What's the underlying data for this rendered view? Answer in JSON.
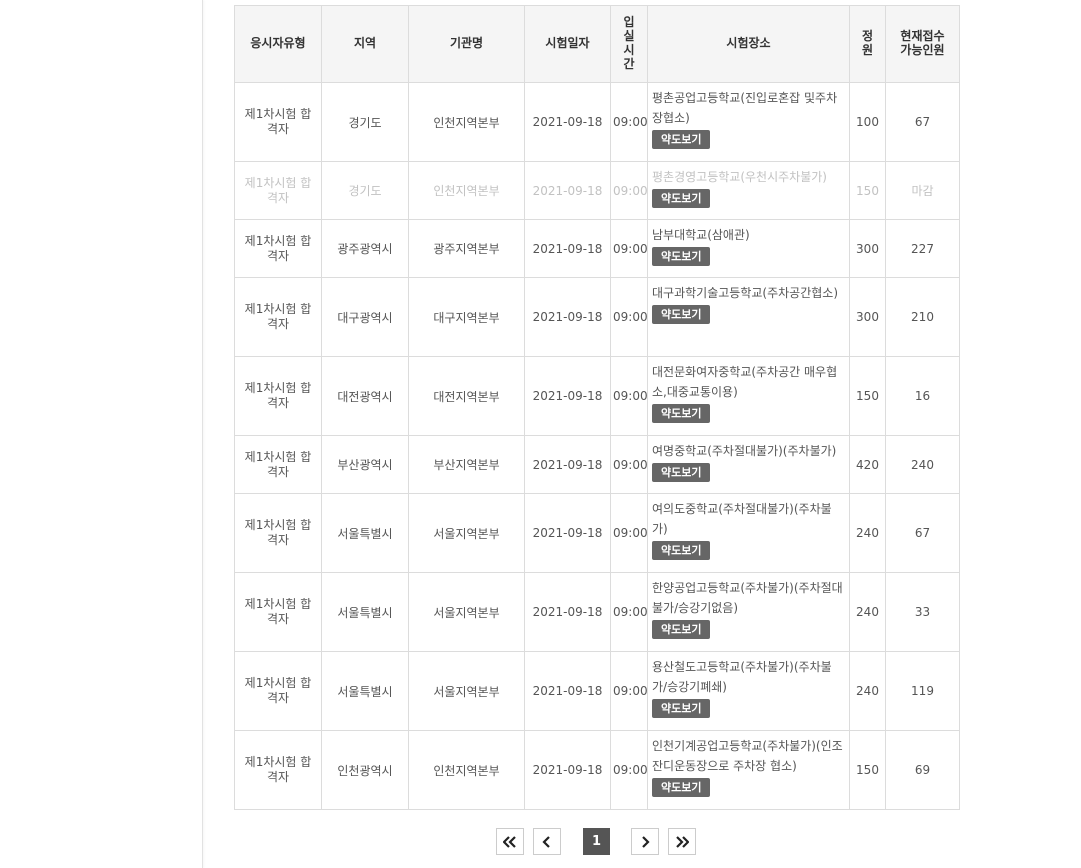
{
  "table": {
    "headers": {
      "type": "응시자유형",
      "region": "지역",
      "org": "기관명",
      "date": "시험일자",
      "entry_time": "입\n실\n시\n간",
      "place": "시험장소",
      "capacity": "정\n원",
      "available": "현재접수\n가능인원"
    },
    "map_button_label": "약도보기",
    "rows": [
      {
        "type": "제1차시험 합격자",
        "region": "경기도",
        "org": "인천지역본부",
        "date": "2021-09-18",
        "time": "09:00",
        "place": "평촌공업고등학교(진입로혼잡 및주차장협소)",
        "capacity": "100",
        "available": "67"
      },
      {
        "type": "제1차시험 합격자",
        "region": "경기도",
        "org": "인천지역본부",
        "date": "2021-09-18",
        "time": "09:00",
        "place": "평촌경영고등학교(우천시주차불가)",
        "capacity": "150",
        "available": "마감"
      },
      {
        "type": "제1차시험 합격자",
        "region": "광주광역시",
        "org": "광주지역본부",
        "date": "2021-09-18",
        "time": "09:00",
        "place": "남부대학교(삼애관)",
        "capacity": "300",
        "available": "227"
      },
      {
        "type": "제1차시험 합격자",
        "region": "대구광역시",
        "org": "대구지역본부",
        "date": "2021-09-18",
        "time": "09:00",
        "place": "대구과학기술고등학교(주차공간협소)",
        "capacity": "300",
        "available": "210"
      },
      {
        "type": "제1차시험 합격자",
        "region": "대전광역시",
        "org": "대전지역본부",
        "date": "2021-09-18",
        "time": "09:00",
        "place": "대전문화여자중학교(주차공간 매우협소,대중교통이용)",
        "capacity": "150",
        "available": "16"
      },
      {
        "type": "제1차시험 합격자",
        "region": "부산광역시",
        "org": "부산지역본부",
        "date": "2021-09-18",
        "time": "09:00",
        "place": "여명중학교(주차절대불가)(주차불가)",
        "capacity": "420",
        "available": "240"
      },
      {
        "type": "제1차시험 합격자",
        "region": "서울특별시",
        "org": "서울지역본부",
        "date": "2021-09-18",
        "time": "09:00",
        "place": "여의도중학교(주차절대불가)(주차불가)",
        "capacity": "240",
        "available": "67"
      },
      {
        "type": "제1차시험 합격자",
        "region": "서울특별시",
        "org": "서울지역본부",
        "date": "2021-09-18",
        "time": "09:00",
        "place": "한양공업고등학교(주차불가)(주차절대불가/승강기없음)",
        "capacity": "240",
        "available": "33"
      },
      {
        "type": "제1차시험 합격자",
        "region": "서울특별시",
        "org": "서울지역본부",
        "date": "2021-09-18",
        "time": "09:00",
        "place": "용산철도고등학교(주차불가)(주차불가/승강기폐쇄)",
        "capacity": "240",
        "available": "119"
      },
      {
        "type": "제1차시험 합격자",
        "region": "인천광역시",
        "org": "인천지역본부",
        "date": "2021-09-18",
        "time": "09:00",
        "place": "인천기계공업고등학교(주차불가)(인조잔디운동장으로 주차장 협소)",
        "capacity": "150",
        "available": "69"
      }
    ]
  },
  "pagination": {
    "first_icon": "double-chevron-left-icon",
    "prev_icon": "chevron-left-icon",
    "current_page": "1",
    "next_icon": "chevron-right-icon",
    "last_icon": "double-chevron-right-icon"
  }
}
